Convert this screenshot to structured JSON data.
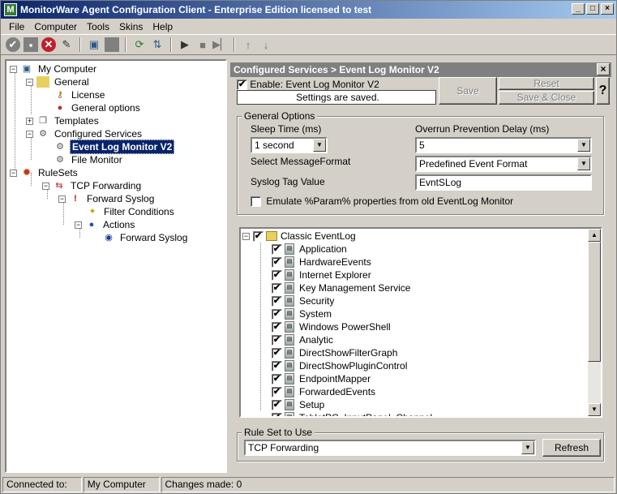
{
  "window": {
    "title": "MonitorWare Agent Configuration Client - Enterprise Edition licensed to test"
  },
  "menu": [
    "File",
    "Computer",
    "Tools",
    "Skins",
    "Help"
  ],
  "toolbar_icons": [
    "check-icon",
    "save-icon",
    "cancel-icon",
    "wand-icon",
    "computer-icon",
    "stop-icon",
    "refresh-icon",
    "export-icon",
    "play-icon",
    "stop-square-icon",
    "step-icon",
    "arrow-up-icon",
    "arrow-down-icon"
  ],
  "tree": {
    "root": "My Computer",
    "general": "General",
    "license": "License",
    "general_options": "General options",
    "templates": "Templates",
    "configured_services": "Configured Services",
    "event_log_monitor": "Event Log Monitor V2",
    "file_monitor": "File Monitor",
    "rulesets": "RuleSets",
    "tcp_forwarding": "TCP Forwarding",
    "forward_syslog": "Forward Syslog",
    "filter_conditions": "Filter Conditions",
    "actions": "Actions",
    "forward_syslog_action": "Forward Syslog"
  },
  "panel": {
    "header": "Configured Services > Event Log Monitor V2",
    "enable_label": "Enable: Event Log Monitor V2",
    "status_text": "Settings are saved.",
    "save": "Save",
    "reset": "Reset",
    "save_close": "Save & Close",
    "help": "?",
    "general_options": {
      "title": "General Options",
      "sleep_label": "Sleep Time (ms)",
      "sleep_value": "1 second",
      "overrun_label": "Overrun Prevention Delay (ms)",
      "overrun_value": "5",
      "format_label": "Select MessageFormat",
      "format_value": "Predefined Event Format",
      "syslog_tag_label": "Syslog Tag Value",
      "syslog_tag_value": "EvntSLog",
      "emulate_label": "Emulate %Param% properties from old EventLog Monitor"
    },
    "eventlog": {
      "root": "Classic EventLog",
      "items": [
        "Application",
        "HardwareEvents",
        "Internet Explorer",
        "Key Management Service",
        "Security",
        "System",
        "Windows PowerShell",
        "Analytic",
        "DirectShowFilterGraph",
        "DirectShowPluginControl",
        "EndpointMapper",
        "ForwardedEvents",
        "Setup",
        "TabletPC_InputPanel_Channel"
      ]
    },
    "ruleset": {
      "title": "Rule Set to Use",
      "value": "TCP Forwarding",
      "refresh": "Refresh"
    }
  },
  "status": {
    "connected_label": "Connected to:",
    "connected_value": "My Computer",
    "changes": "Changes made: 0"
  }
}
